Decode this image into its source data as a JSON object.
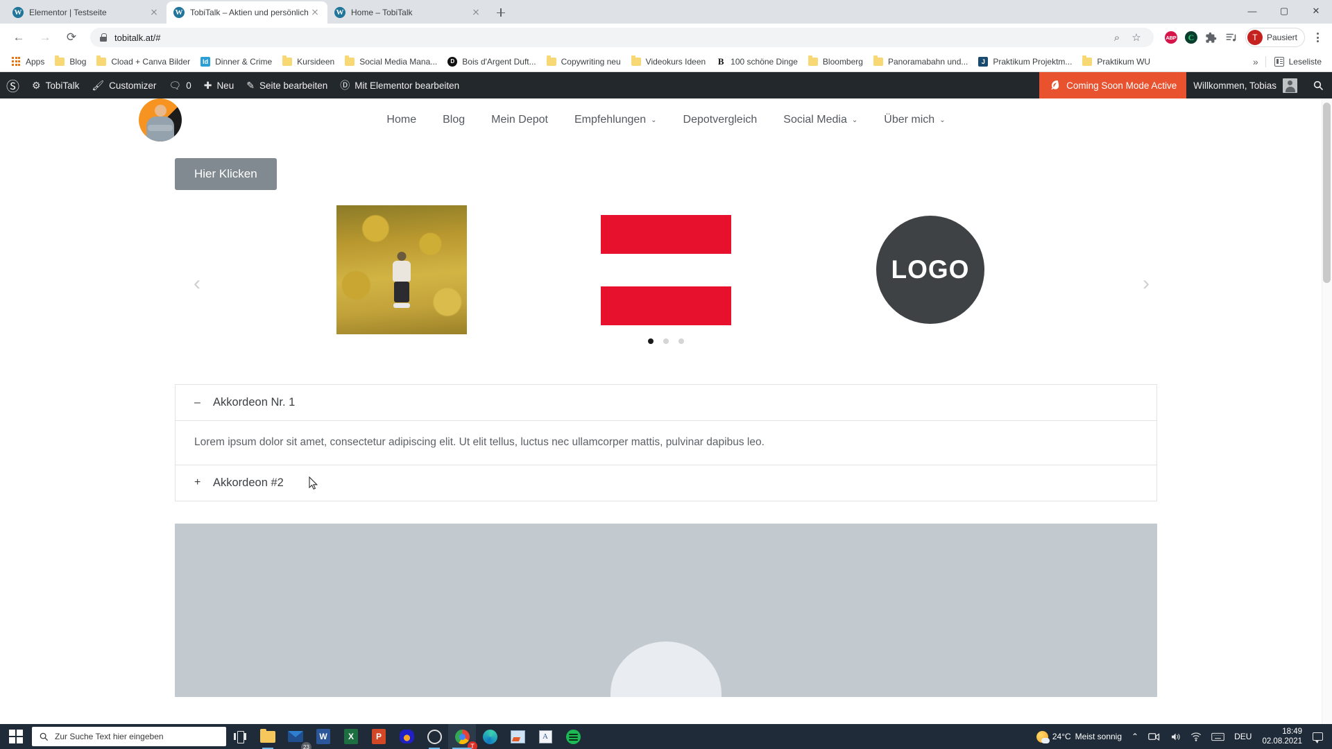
{
  "browser": {
    "tabs": [
      {
        "title": "Elementor | Testseite",
        "active": false,
        "favicon": "wordpress-icon"
      },
      {
        "title": "TobiTalk – Aktien und persönlich",
        "active": true,
        "favicon": "wordpress-icon"
      },
      {
        "title": "Home – TobiTalk",
        "active": false,
        "favicon": "wordpress-icon"
      }
    ],
    "new_tab_label": "+",
    "window_controls": {
      "minimize": "—",
      "maximize": "▢",
      "close": "✕"
    },
    "nav": {
      "back": "←",
      "forward": "→",
      "reload": "⟳"
    },
    "omnibox": {
      "url": "tobitalk.at/#",
      "lock_icon": "lock-icon",
      "zoom_icon": "zoom-in-icon",
      "bookmark_icon": "star-icon"
    },
    "extensions": [
      {
        "name": "adblock-plus-icon",
        "label": "ABP"
      },
      {
        "name": "ghostery-icon",
        "label": "C"
      },
      {
        "name": "extensions-puzzle-icon",
        "label": "🧩"
      },
      {
        "name": "media-list-icon",
        "label": "≡♪"
      }
    ],
    "profile": {
      "initial": "T",
      "label": "Pausiert"
    },
    "menu_icon": "three-dot-menu-icon",
    "bookmarks": [
      {
        "label": "Apps",
        "icon": "apps-grid-icon"
      },
      {
        "label": "Blog",
        "icon": "folder-icon"
      },
      {
        "label": "Cload + Canva Bilder",
        "icon": "folder-icon"
      },
      {
        "label": "Dinner & Crime",
        "icon": "indesign-icon"
      },
      {
        "label": "Kursideen",
        "icon": "folder-icon"
      },
      {
        "label": "Social Media Mana...",
        "icon": "folder-icon"
      },
      {
        "label": "Bois d'Argent Duft...",
        "icon": "dior-icon"
      },
      {
        "label": "Copywriting neu",
        "icon": "folder-icon"
      },
      {
        "label": "Videokurs Ideen",
        "icon": "folder-icon"
      },
      {
        "label": "100 schöne Dinge",
        "icon": "serif-b-icon"
      },
      {
        "label": "Bloomberg",
        "icon": "folder-icon"
      },
      {
        "label": "Panoramabahn und...",
        "icon": "folder-icon"
      },
      {
        "label": "Praktikum Projektm...",
        "icon": "jobs-icon"
      },
      {
        "label": "Praktikum WU",
        "icon": "folder-icon"
      }
    ],
    "bookmarks_overflow": "»",
    "reading_list": {
      "label": "Leseliste",
      "icon": "reading-list-icon"
    }
  },
  "wpadminbar": {
    "logo": "wordpress-logo",
    "items": [
      {
        "label": "TobiTalk",
        "icon": "dashboard-icon"
      },
      {
        "label": "Customizer",
        "icon": "paintbrush-icon"
      },
      {
        "label": "0",
        "icon": "comment-bubble-icon"
      },
      {
        "label": "Neu",
        "icon": "plus-icon"
      },
      {
        "label": "Seite bearbeiten",
        "icon": "pencil-icon"
      },
      {
        "label": "Mit Elementor bearbeiten",
        "icon": "elementor-icon"
      }
    ],
    "coming_soon": {
      "label": "Coming Soon Mode Active",
      "icon": "seedprod-leaf-icon",
      "color": "#e8522e"
    },
    "welcome": {
      "label": "Willkommen, Tobias",
      "avatar": "user-avatar"
    },
    "search_icon": "search-icon"
  },
  "site": {
    "logo": "profile-avatar-logo",
    "nav": [
      {
        "label": "Home",
        "has_dropdown": false
      },
      {
        "label": "Blog",
        "has_dropdown": false
      },
      {
        "label": "Mein Depot",
        "has_dropdown": false
      },
      {
        "label": "Empfehlungen",
        "has_dropdown": true
      },
      {
        "label": "Depotvergleich",
        "has_dropdown": false
      },
      {
        "label": "Social Media",
        "has_dropdown": true
      },
      {
        "label": "Über mich",
        "has_dropdown": true
      }
    ],
    "caret": "⌄",
    "cta_button": "Hier Klicken",
    "carousel": {
      "prev_arrow": "‹",
      "next_arrow": "›",
      "slides": [
        {
          "type": "photo",
          "alt": "autumn-forest-photo"
        },
        {
          "type": "red-bars",
          "alt": "red-bars-graphic",
          "color": "#e8112d"
        },
        {
          "type": "logo",
          "label": "LOGO",
          "color": "#3f4244"
        }
      ],
      "dots": [
        {
          "active": true
        },
        {
          "active": false
        },
        {
          "active": false
        }
      ]
    },
    "accordion": [
      {
        "sign": "–",
        "title": "Akkordeon Nr. 1",
        "expanded": true,
        "body": "Lorem ipsum dolor sit amet, consectetur adipiscing elit. Ut elit tellus, luctus nec ullamcorper mattis, pulvinar dapibus leo."
      },
      {
        "sign": "+",
        "title": "Akkordeon #2",
        "expanded": false,
        "body": ""
      }
    ]
  },
  "taskbar": {
    "start_icon": "windows-start-icon",
    "search_placeholder": "Zur Suche Text hier eingeben",
    "search_icon": "search-icon",
    "taskview_icon": "task-view-icon",
    "apps": [
      {
        "name": "file-explorer-icon",
        "running": true
      },
      {
        "name": "mail-icon",
        "badge": "23",
        "running": false
      },
      {
        "name": "word-icon",
        "label": "W",
        "running": false
      },
      {
        "name": "excel-icon",
        "label": "X",
        "running": false
      },
      {
        "name": "powerpoint-icon",
        "label": "P",
        "running": false
      },
      {
        "name": "headphones-icon",
        "running": false
      },
      {
        "name": "obs-studio-icon",
        "running": true
      },
      {
        "name": "chrome-icon",
        "badge": "T",
        "running": true,
        "active": true
      },
      {
        "name": "edge-icon",
        "running": false
      },
      {
        "name": "photo-editor-icon",
        "running": false
      },
      {
        "name": "notes-icon",
        "running": false
      },
      {
        "name": "spotify-icon",
        "running": false
      }
    ],
    "tray": {
      "weather_temp": "24°C",
      "weather_desc": "Meist sonnig",
      "chevron": "⌃",
      "icons": [
        "meet-now-icon",
        "volume-icon",
        "network-icon",
        "keyboard-icon"
      ],
      "language": "DEU",
      "time": "18:49",
      "date": "02.08.2021",
      "notification_icon": "action-center-icon"
    }
  }
}
